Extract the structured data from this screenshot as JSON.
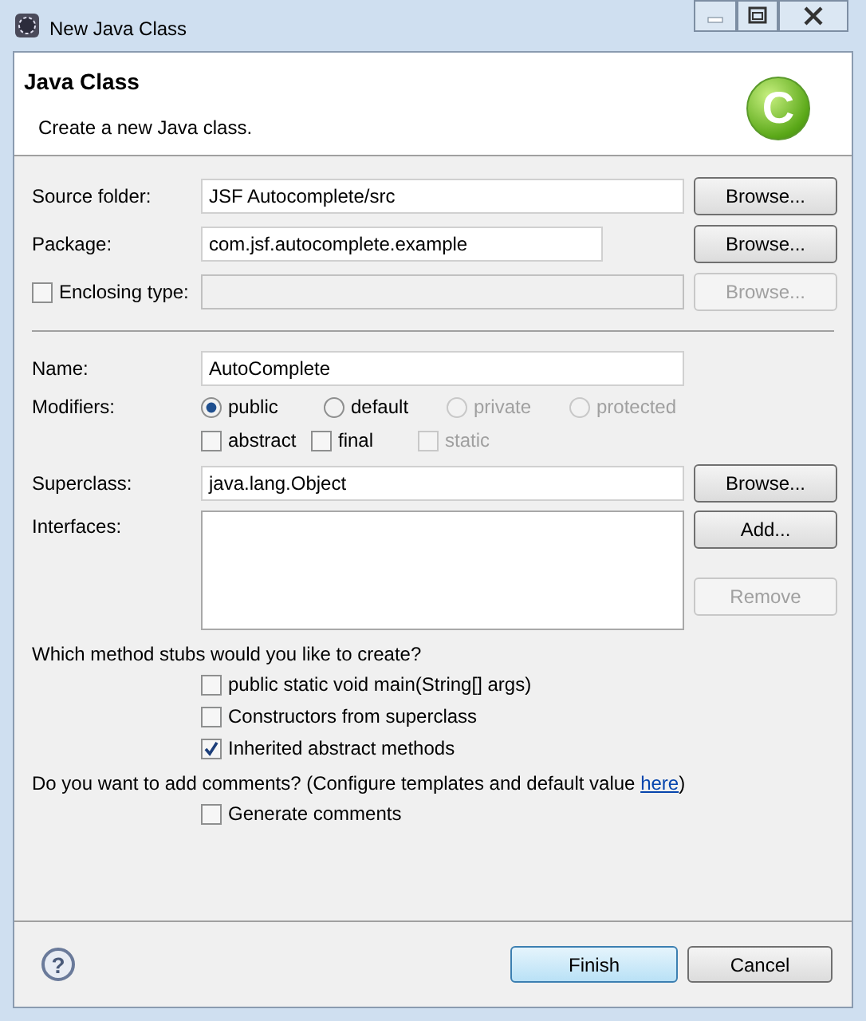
{
  "window": {
    "title": "New Java Class"
  },
  "header": {
    "title": "Java Class",
    "description": "Create a new Java class.",
    "icon_letter": "C"
  },
  "source_folder": {
    "label": "Source folder:",
    "value": "JSF Autocomplete/src",
    "button": {
      "label": "Browse...",
      "disabled": false
    }
  },
  "package": {
    "label": "Package:",
    "value": "com.jsf.autocomplete.example",
    "button": {
      "label": "Browse...",
      "disabled": false
    }
  },
  "enclosing_type": {
    "label": "Enclosing type:",
    "checked": false,
    "field_disabled": true,
    "button": {
      "label": "Browse...",
      "disabled": true
    }
  },
  "name": {
    "label": "Name:",
    "value": "AutoComplete"
  },
  "modifiers": {
    "label": "Modifiers:",
    "radios": [
      {
        "label": "public",
        "selected": true,
        "disabled": false
      },
      {
        "label": "default",
        "selected": false,
        "disabled": false
      },
      {
        "label": "private",
        "selected": false,
        "disabled": true
      },
      {
        "label": "protected",
        "selected": false,
        "disabled": true
      }
    ],
    "checkboxes": [
      {
        "label": "abstract",
        "checked": false,
        "disabled": false
      },
      {
        "label": "final",
        "checked": false,
        "disabled": false
      },
      {
        "label": "static",
        "checked": false,
        "disabled": true
      }
    ]
  },
  "superclass": {
    "label": "Superclass:",
    "value": "java.lang.Object",
    "button": {
      "label": "Browse...",
      "disabled": false
    }
  },
  "interfaces": {
    "label": "Interfaces:",
    "buttons": [
      {
        "label": "Add...",
        "disabled": false
      },
      {
        "label": "Remove",
        "disabled": true
      }
    ]
  },
  "method_stubs": {
    "question": "Which method stubs would you like to create?",
    "options": [
      {
        "label": "public static void main(String[] args)",
        "checked": false
      },
      {
        "label": "Constructors from superclass",
        "checked": false
      },
      {
        "label": "Inherited abstract methods",
        "checked": true
      }
    ]
  },
  "comments": {
    "question": "Do you want to add comments? (Configure templates and default value ",
    "link": "here",
    "closing": ")",
    "options": [
      {
        "label": "Generate comments",
        "checked": false
      }
    ]
  },
  "footer": {
    "help": "?",
    "buttons": [
      {
        "label": "Finish",
        "default": true
      },
      {
        "label": "Cancel",
        "default": false
      }
    ]
  }
}
